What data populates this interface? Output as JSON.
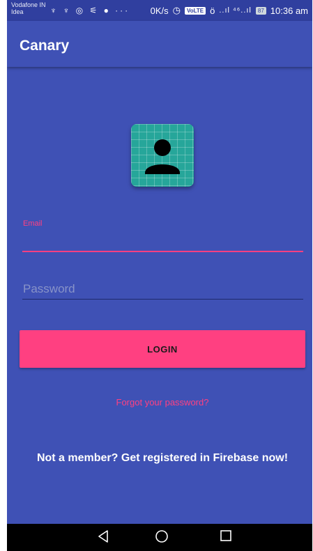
{
  "status_bar": {
    "carrier_line1": "Vodafone IN",
    "carrier_line2": "Idea",
    "notification_icons": "♆ ♆ ◎ ⚟ ● ···",
    "network_speed": "0K/s",
    "volte_badge": "VoLTE",
    "signal": "..ıl ⁴⁶..ıl",
    "battery": "87",
    "time": "10:36 am"
  },
  "app_bar": {
    "title": "Canary"
  },
  "avatar": {
    "icon": "person-icon",
    "background_color": "#26a69a"
  },
  "form": {
    "email_label": "Email",
    "email_value": "",
    "password_placeholder": "Password",
    "password_value": ""
  },
  "login_button": {
    "label": "LOGIN"
  },
  "links": {
    "forgot_password": "Forgot your password?",
    "register": "Not a member? Get registered in Firebase now!"
  },
  "nav_bar": {
    "back_icon": "back-triangle-icon",
    "home_icon": "home-circle-icon",
    "recents_icon": "recents-square-icon"
  },
  "colors": {
    "primary": "#3f51b5",
    "primary_dark": "#303f9f",
    "accent": "#ff4081"
  }
}
